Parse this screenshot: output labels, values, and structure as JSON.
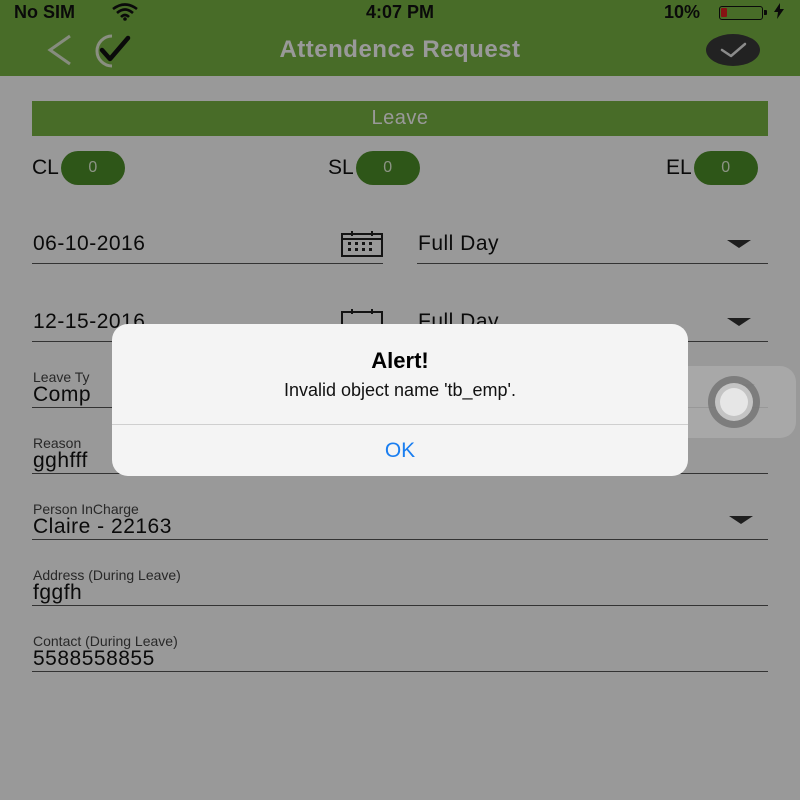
{
  "status_bar": {
    "carrier": "No SIM",
    "time": "4:07 PM",
    "battery_percent": "10%",
    "battery_level": 0.1
  },
  "nav": {
    "title": "Attendence Request",
    "accent_color": "#79b543"
  },
  "form": {
    "section_label": "Leave",
    "balances": [
      {
        "label": "CL",
        "value": "0"
      },
      {
        "label": "SL",
        "value": "0"
      },
      {
        "label": "EL",
        "value": "0"
      }
    ],
    "from_date": "06-10-2016",
    "from_duration": "Full Day",
    "to_date": "12-15-2016",
    "to_duration": "Full Day",
    "leave_type": {
      "label": "Leave Ty",
      "value": "Comp"
    },
    "reason": {
      "label": "Reason",
      "value": "gghfff"
    },
    "person_incharge": {
      "label": "Person InCharge",
      "value": "Claire - 22163"
    },
    "address": {
      "label": "Address (During Leave)",
      "value": "fggfh"
    },
    "contact": {
      "label": "Contact (During Leave)",
      "value": "5588558855"
    }
  },
  "alert": {
    "title": "Alert!",
    "message": "Invalid object name 'tb_emp'.",
    "ok_label": "OK"
  }
}
